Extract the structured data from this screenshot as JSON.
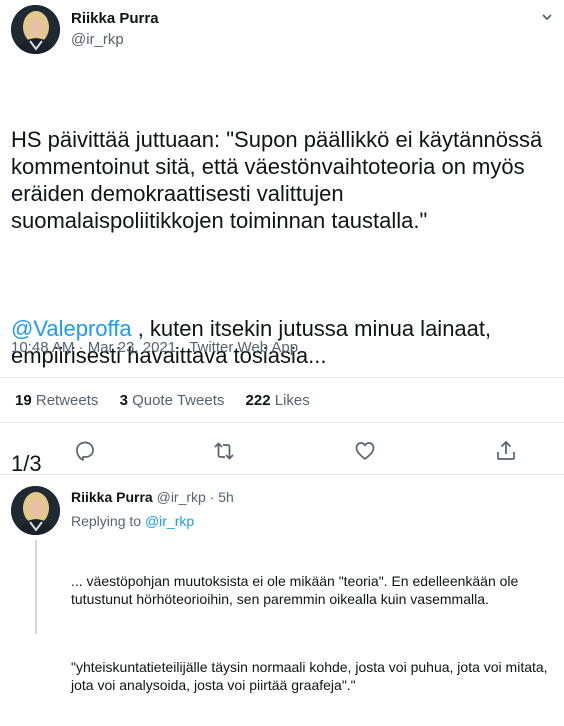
{
  "tweet": {
    "author_name": "Riikka Purra",
    "author_handle": "@ir_rkp",
    "paragraphs": [
      "HS päivittää juttuaan: \"Supon päällikkö ei käytännössä kommentoinut sitä, että väestönvaihtoteoria on myös eräiden demokraattisesti valittujen suomalaispoliitikkojen toiminnan taustalla.\"",
      "1/3"
    ],
    "mention": "@Valeproffa",
    "mention_rest": " , kuten itsekin jutussa minua lainaat, empiirisesti havaittava tosiasia...",
    "meta": "10:48 AM · Mar 23, 2021 · Twitter Web App"
  },
  "stats": {
    "retweets": {
      "count": "19",
      "label": "Retweets"
    },
    "quotes": {
      "count": "3",
      "label": "Quote Tweets"
    },
    "likes": {
      "count": "222",
      "label": "Likes"
    }
  },
  "actions": {
    "icons": [
      "reply-icon",
      "retweet-icon",
      "like-icon",
      "share-icon"
    ]
  },
  "reply": {
    "author_name": "Riikka Purra",
    "meta": "@ir_rkp · 5h",
    "replying_label": "Replying to",
    "replying_to": "@ir_rkp",
    "paragraphs": [
      "... väestöpohjan muutoksista ei ole mikään \"teoria\". En edelleenkään ole tutustunut hörhöteorioihin, sen paremmin oikealla kuin vasemmalla.",
      "\"yhteiskuntatieteilijälle täysin normaali kohde, josta voi puhua, jota voi mitata, jota voi analysoida, josta voi piirtää graafeja\".\""
    ]
  },
  "colors": {
    "text": "#0f1419",
    "secondary": "#536471",
    "link": "#1d9bf0",
    "divider": "#dfe5e9"
  }
}
